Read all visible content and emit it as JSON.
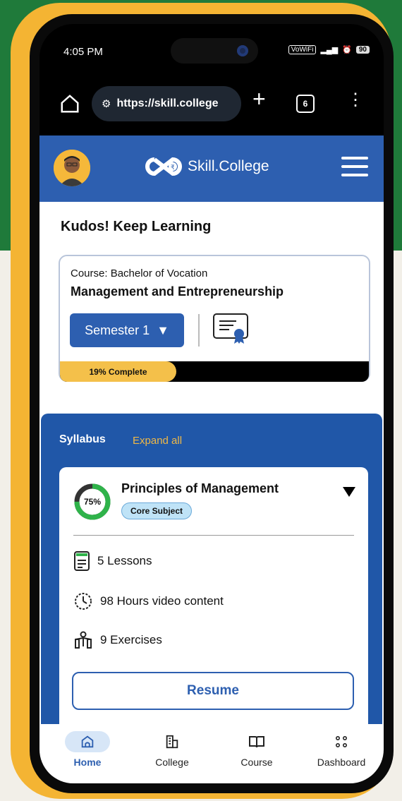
{
  "status_bar": {
    "time": "4:05 PM",
    "vowifi": "VoWiFi",
    "battery": "90"
  },
  "browser": {
    "url": "https://skill.college",
    "tab_count": "6"
  },
  "header": {
    "brand": "Skill.College"
  },
  "page": {
    "greeting": "Kudos! Keep Learning"
  },
  "course": {
    "label": "Course: Bachelor of Vocation",
    "name": "Management and Entrepreneurship",
    "semester": "Semester 1",
    "progress_text": "19% Complete",
    "progress_value": 19
  },
  "syllabus": {
    "title": "Syllabus",
    "expand_label": "Expand all",
    "subject": {
      "percent_text": "75%",
      "percent_value": 75,
      "name": "Principles of Management",
      "badge": "Core Subject",
      "lessons": "5 Lessons",
      "video": "98 Hours video content",
      "exercises": "9 Exercises",
      "resume_label": "Resume"
    }
  },
  "nav": {
    "home": "Home",
    "college": "College",
    "course": "Course",
    "dashboard": "Dashboard"
  },
  "colors": {
    "brand_blue": "#2d5fb0",
    "gold": "#f4b433",
    "green": "#1f7a3a"
  }
}
